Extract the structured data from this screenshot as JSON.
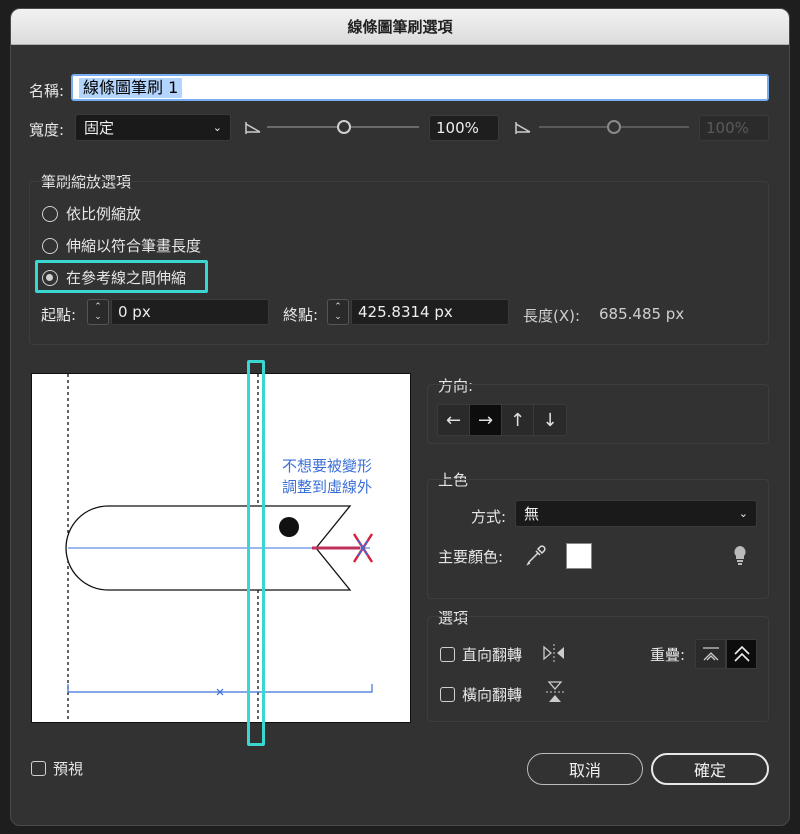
{
  "window": {
    "title": "線條圖筆刷選項"
  },
  "name": {
    "label": "名稱:",
    "value": "線條圖筆刷 1"
  },
  "width": {
    "label": "寬度:",
    "mode": "固定",
    "value": "100%",
    "value_disabled": "100%"
  },
  "scale_options": {
    "title": "筆刷縮放選項",
    "options": [
      {
        "label": "依比例縮放",
        "selected": false
      },
      {
        "label": "伸縮以符合筆畫長度",
        "selected": false
      },
      {
        "label": "在參考線之間伸縮",
        "selected": true
      }
    ],
    "start_label": "起點:",
    "start_value": "0 px",
    "end_label": "終點:",
    "end_value": "425.8314 px",
    "length_label": "長度(X):",
    "length_value": "685.485 px"
  },
  "preview_annotation": {
    "line1": "不想要被變形",
    "line2": "調整到虛線外"
  },
  "direction": {
    "title": "方向:",
    "buttons": [
      "←",
      "→",
      "↑",
      "↓"
    ],
    "selected_index": 1
  },
  "colorize": {
    "title": "上色",
    "method_label": "方式:",
    "method_value": "無",
    "key_color_label": "主要顏色:"
  },
  "options": {
    "title": "選項",
    "flip_along": "直向翻轉",
    "flip_across": "橫向翻轉",
    "overlap_label": "重疊:"
  },
  "footer": {
    "preview_label": "預視",
    "cancel": "取消",
    "ok": "確定"
  },
  "colors": {
    "highlight": "#3ad6d2",
    "annotation": "#3a6fd8",
    "selection": "#b3d4fc"
  }
}
